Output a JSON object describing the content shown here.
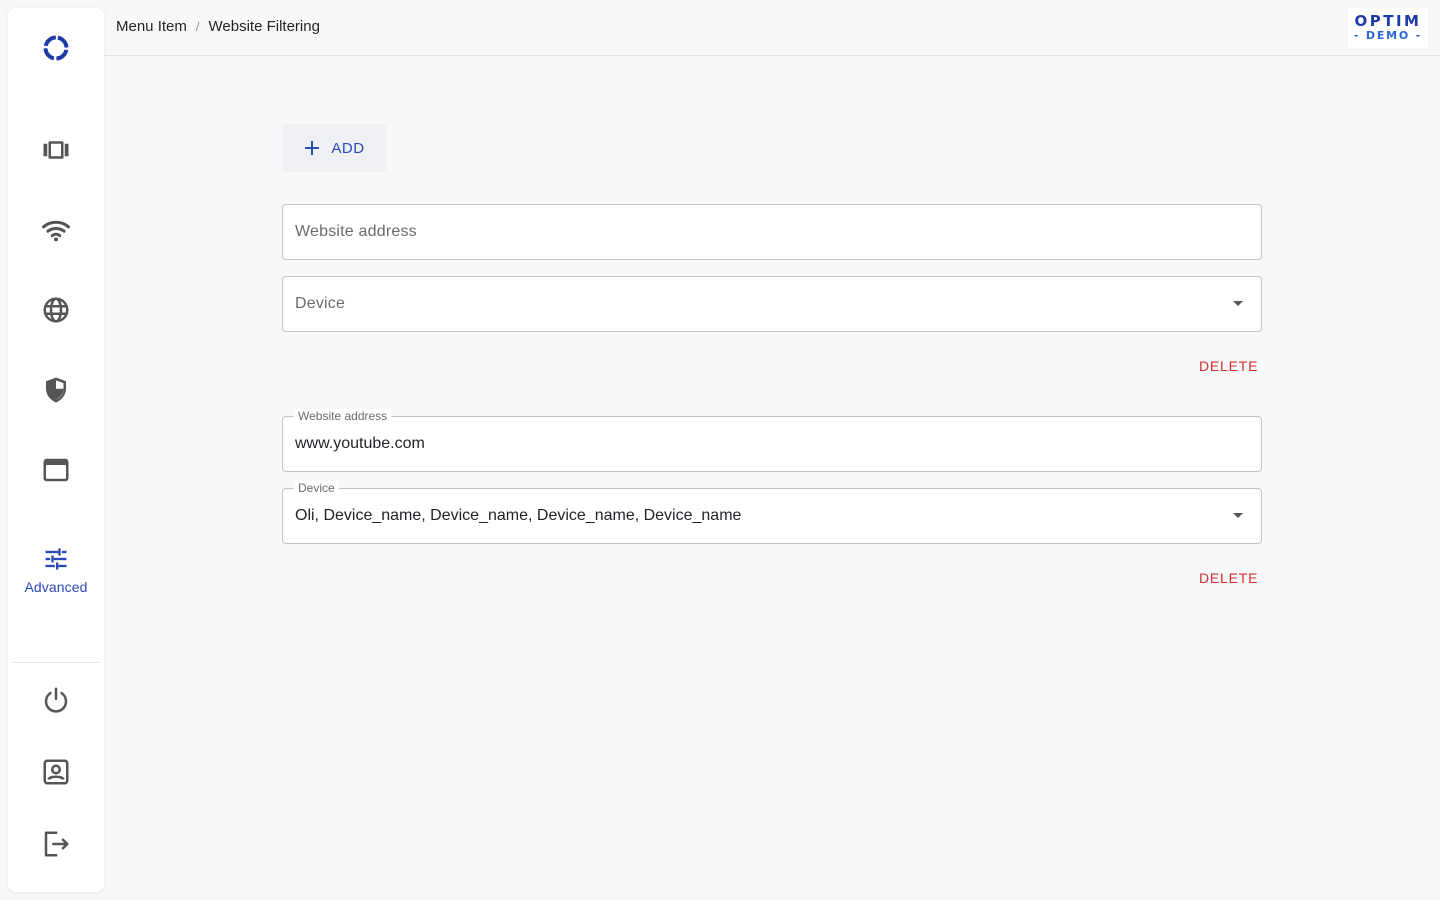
{
  "sidebar": {
    "logo": "optim-ring-logo",
    "items": [
      {
        "icon": "devices-icon",
        "label": ""
      },
      {
        "icon": "wifi-icon",
        "label": ""
      },
      {
        "icon": "globe-icon",
        "label": ""
      },
      {
        "icon": "shield-icon",
        "label": ""
      },
      {
        "icon": "window-icon",
        "label": ""
      },
      {
        "icon": "tune-icon",
        "label": "Advanced",
        "active": true
      }
    ],
    "bottom_items": [
      {
        "icon": "power-icon"
      },
      {
        "icon": "account-icon"
      },
      {
        "icon": "logout-icon"
      }
    ]
  },
  "header": {
    "breadcrumb": [
      "Menu Item",
      "Website Filtering"
    ],
    "brand_top": "OPTIM",
    "brand_bottom": "- DEMO -"
  },
  "main": {
    "add_label": "ADD",
    "entries": [
      {
        "website": {
          "label": "Website address",
          "value": "",
          "placeholder": "Website address"
        },
        "device": {
          "label": "Device",
          "value": "",
          "placeholder": "Device"
        },
        "delete_label": "DELETE"
      },
      {
        "website": {
          "label": "Website address",
          "value": "www.youtube.com"
        },
        "device": {
          "label": "Device",
          "value": "Oli, Device_name, Device_name, Device_name, Device_name"
        },
        "delete_label": "DELETE"
      }
    ]
  },
  "colors": {
    "accent": "#2a48b8",
    "danger": "#d32f2f",
    "background": "#f8f8f8"
  }
}
